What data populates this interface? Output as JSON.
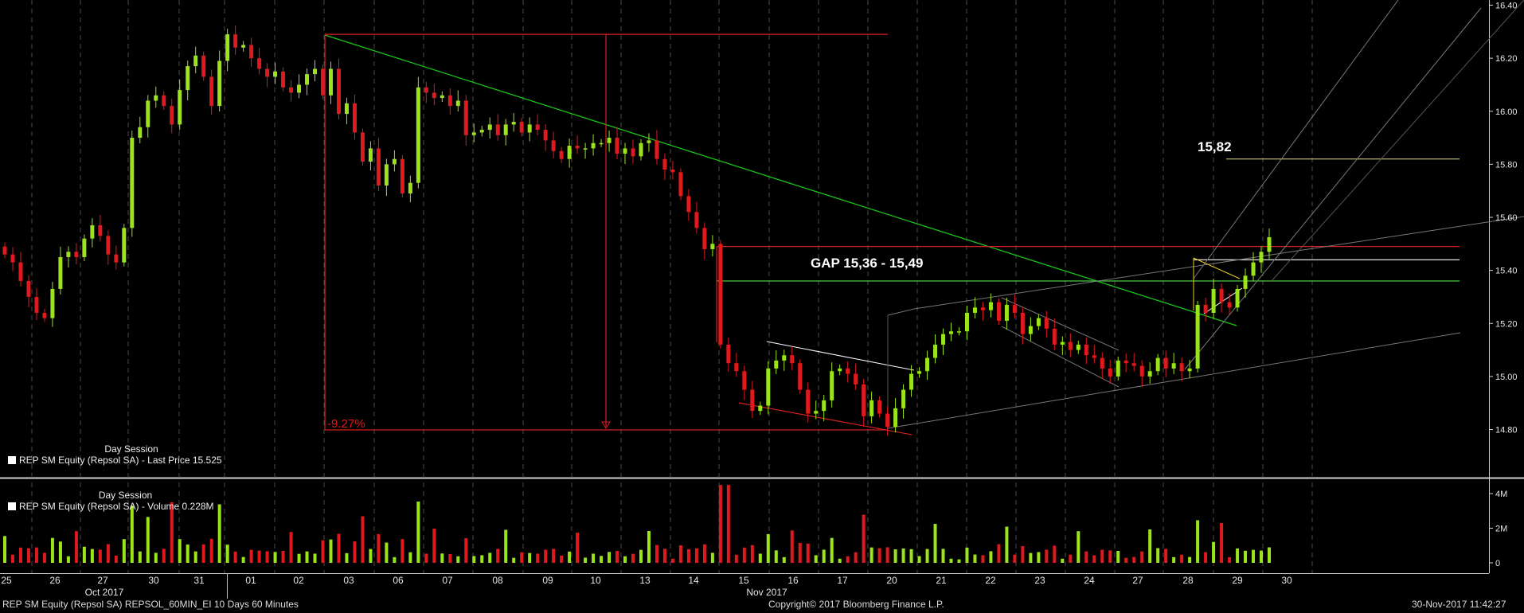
{
  "chart_data": {
    "type": "candlestick",
    "security": "REP SM Equity (Repsol SA)",
    "price_panel": {
      "session_label": "Day Session",
      "legend_label": "REP SM Equity (Repsol SA) - Last Price 15.525",
      "ylim": [
        14.6,
        16.4
      ],
      "yticks": [
        "14.80",
        "15.00",
        "15.20",
        "15.40",
        "15.60",
        "15.80",
        "16.00",
        "16.20",
        "16.40"
      ],
      "ytick_values": [
        14.8,
        15.0,
        15.2,
        15.4,
        15.6,
        15.8,
        16.0,
        16.2,
        16.4
      ],
      "colors": {
        "up": "#9be41a",
        "down": "#e0191e",
        "trend": "#19c419",
        "gap_top": "#d42020",
        "gap_bottom": "#44b83a"
      },
      "closes": [
        15.46,
        15.43,
        15.36,
        15.3,
        15.24,
        15.22,
        15.33,
        15.45,
        15.47,
        15.45,
        15.52,
        15.57,
        15.53,
        15.46,
        15.43,
        15.56,
        15.9,
        15.94,
        16.04,
        16.06,
        16.02,
        15.95,
        16.08,
        16.17,
        16.21,
        16.13,
        16.02,
        16.19,
        16.29,
        16.24,
        16.25,
        16.2,
        16.16,
        16.13,
        16.15,
        16.09,
        16.07,
        16.1,
        16.14,
        16.16,
        16.06,
        16.16,
        15.99,
        16.03,
        15.92,
        15.81,
        15.86,
        15.72,
        15.8,
        15.82,
        15.69,
        15.73,
        16.09,
        16.07,
        16.05,
        16.06,
        16.02,
        16.04,
        15.91,
        15.92,
        15.93,
        15.95,
        15.91,
        15.95,
        15.96,
        15.92,
        15.95,
        15.93,
        15.89,
        15.85,
        15.82,
        15.87,
        15.86,
        15.86,
        15.88,
        15.88,
        15.9,
        15.84,
        15.86,
        15.83,
        15.88,
        15.89,
        15.82,
        15.78,
        15.77,
        15.68,
        15.62,
        15.56,
        15.48,
        15.5,
        15.12,
        15.05,
        15.02,
        14.95,
        14.87,
        14.89,
        15.03,
        15.06,
        15.08,
        15.05,
        14.95,
        14.86,
        14.87,
        14.91,
        15.02,
        15.03,
        15.01,
        14.97,
        14.85,
        14.91,
        14.86,
        14.81,
        14.88,
        14.95,
        15.01,
        15.02,
        15.07,
        15.12,
        15.16,
        15.17,
        15.17,
        15.24,
        15.26,
        15.25,
        15.28,
        15.21,
        15.27,
        15.24,
        15.16,
        15.19,
        15.22,
        15.18,
        15.12,
        15.13,
        15.1,
        15.12,
        15.08,
        15.07,
        15.03,
        15.0,
        15.06,
        15.05,
        15.04,
        15.0,
        15.02,
        15.07,
        15.03,
        15.05,
        15.02,
        15.03,
        15.27,
        15.24,
        15.33,
        15.28,
        15.26,
        15.33,
        15.38,
        15.43,
        15.47,
        15.525
      ],
      "annotations": [
        {
          "text": "GAP 15,36 - 15,49"
        },
        {
          "text": "15,82"
        },
        {
          "text": "-9.27%"
        }
      ],
      "levels": [
        15.82,
        15.49,
        15.44,
        15.36,
        16.29,
        14.77
      ]
    },
    "volume_panel": {
      "session_label": "Day Session",
      "legend_label": "REP SM Equity (Repsol SA) - Volume 0.228M",
      "ylim": [
        0,
        4.6
      ],
      "yticks": [
        "0",
        "2M",
        "4M"
      ],
      "ytick_values": [
        0,
        2,
        4
      ]
    },
    "x_axis": {
      "day_labels": [
        "25",
        "26",
        "27",
        "30",
        "31",
        "01",
        "02",
        "03",
        "06",
        "07",
        "08",
        "09",
        "10",
        "13",
        "14",
        "15",
        "16",
        "17",
        "20",
        "21",
        "22",
        "23",
        "24",
        "27",
        "28",
        "29",
        "30"
      ],
      "month_labels": [
        "Oct 2017",
        "Nov 2017"
      ]
    }
  },
  "footer": {
    "left": "REP SM Equity (Repsol SA) REPSOL_60MIN_EI 10 Days 60 Minutes",
    "center": "Copyright© 2017 Bloomberg Finance L.P.",
    "right": "30-Nov-2017 11:42:27"
  }
}
